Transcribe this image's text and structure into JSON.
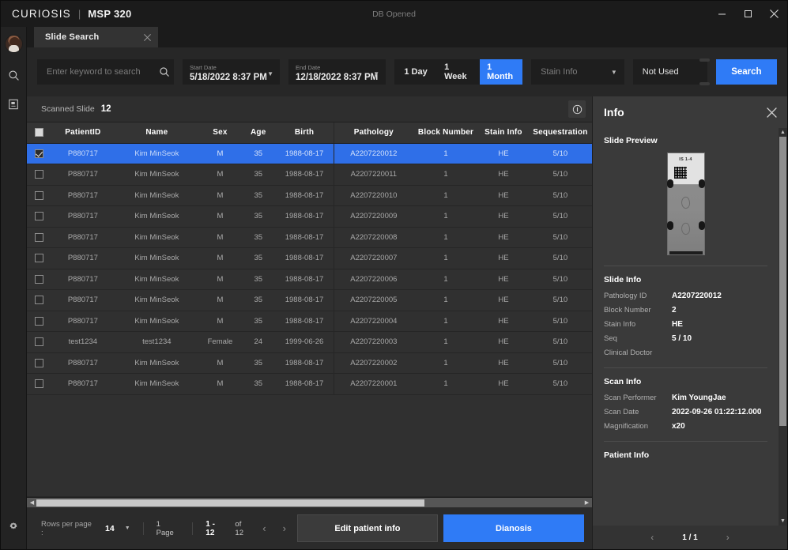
{
  "titlebar": {
    "brand": "CURIOSIS",
    "separator": "|",
    "model": "MSP 320",
    "db_status": "DB Opened",
    "minimize": "minimize-icon",
    "maximize": "maximize-icon",
    "close": "close-icon"
  },
  "rail": {
    "avatar": "user-avatar",
    "items": [
      {
        "icon": "search-icon"
      },
      {
        "icon": "book-icon"
      }
    ],
    "settings": {
      "icon": "gear-icon"
    }
  },
  "tabs": [
    {
      "label": "Slide Search",
      "close": "close-icon",
      "active": true
    }
  ],
  "toolbar": {
    "search_placeholder": "Enter keyword to search",
    "search_value": "",
    "start_date": {
      "caption": "Start Date",
      "value": "5/18/2022 8:37 PM"
    },
    "end_date": {
      "caption": "End Date",
      "value": "12/18/2022 8:37 PM"
    },
    "ranges": [
      {
        "label": "1 Day",
        "active": false
      },
      {
        "label": "1 Week",
        "active": false
      },
      {
        "label": "1 Month",
        "active": true
      }
    ],
    "stain_select": "Stain Info",
    "not_used": "Not Used",
    "search_button": "Search"
  },
  "list": {
    "scanned_label": "Scanned Slide",
    "scanned_count": "12",
    "info_icon": "info-circle-icon",
    "columns": [
      "PatientID",
      "Name",
      "Sex",
      "Age",
      "Birth",
      "Pathology",
      "Block Number",
      "Stain Info",
      "Sequestration"
    ],
    "rows": [
      {
        "selected": true,
        "checked": true,
        "patient_id": "P880717",
        "name": "Kim MinSeok",
        "sex": "M",
        "age": "35",
        "birth": "1988-08-17",
        "pathology": "A2207220012",
        "block_number": "1",
        "stain_info": "HE",
        "sequestration": "5/10"
      },
      {
        "selected": false,
        "checked": false,
        "patient_id": "P880717",
        "name": "Kim MinSeok",
        "sex": "M",
        "age": "35",
        "birth": "1988-08-17",
        "pathology": "A2207220011",
        "block_number": "1",
        "stain_info": "HE",
        "sequestration": "5/10"
      },
      {
        "selected": false,
        "checked": false,
        "patient_id": "P880717",
        "name": "Kim MinSeok",
        "sex": "M",
        "age": "35",
        "birth": "1988-08-17",
        "pathology": "A2207220010",
        "block_number": "1",
        "stain_info": "HE",
        "sequestration": "5/10"
      },
      {
        "selected": false,
        "checked": false,
        "patient_id": "P880717",
        "name": "Kim MinSeok",
        "sex": "M",
        "age": "35",
        "birth": "1988-08-17",
        "pathology": "A2207220009",
        "block_number": "1",
        "stain_info": "HE",
        "sequestration": "5/10"
      },
      {
        "selected": false,
        "checked": false,
        "patient_id": "P880717",
        "name": "Kim MinSeok",
        "sex": "M",
        "age": "35",
        "birth": "1988-08-17",
        "pathology": "A2207220008",
        "block_number": "1",
        "stain_info": "HE",
        "sequestration": "5/10"
      },
      {
        "selected": false,
        "checked": false,
        "patient_id": "P880717",
        "name": "Kim MinSeok",
        "sex": "M",
        "age": "35",
        "birth": "1988-08-17",
        "pathology": "A2207220007",
        "block_number": "1",
        "stain_info": "HE",
        "sequestration": "5/10"
      },
      {
        "selected": false,
        "checked": false,
        "patient_id": "P880717",
        "name": "Kim MinSeok",
        "sex": "M",
        "age": "35",
        "birth": "1988-08-17",
        "pathology": "A2207220006",
        "block_number": "1",
        "stain_info": "HE",
        "sequestration": "5/10"
      },
      {
        "selected": false,
        "checked": false,
        "patient_id": "P880717",
        "name": "Kim MinSeok",
        "sex": "M",
        "age": "35",
        "birth": "1988-08-17",
        "pathology": "A2207220005",
        "block_number": "1",
        "stain_info": "HE",
        "sequestration": "5/10"
      },
      {
        "selected": false,
        "checked": false,
        "patient_id": "P880717",
        "name": "Kim MinSeok",
        "sex": "M",
        "age": "35",
        "birth": "1988-08-17",
        "pathology": "A2207220004",
        "block_number": "1",
        "stain_info": "HE",
        "sequestration": "5/10"
      },
      {
        "selected": false,
        "checked": false,
        "patient_id": "test1234",
        "name": "test1234",
        "sex": "Female",
        "age": "24",
        "birth": "1999-06-26",
        "pathology": "A2207220003",
        "block_number": "1",
        "stain_info": "HE",
        "sequestration": "5/10"
      },
      {
        "selected": false,
        "checked": false,
        "patient_id": "P880717",
        "name": "Kim MinSeok",
        "sex": "M",
        "age": "35",
        "birth": "1988-08-17",
        "pathology": "A2207220002",
        "block_number": "1",
        "stain_info": "HE",
        "sequestration": "5/10"
      },
      {
        "selected": false,
        "checked": false,
        "patient_id": "P880717",
        "name": "Kim MinSeok",
        "sex": "M",
        "age": "35",
        "birth": "1988-08-17",
        "pathology": "A2207220001",
        "block_number": "1",
        "stain_info": "HE",
        "sequestration": "5/10"
      }
    ]
  },
  "footer": {
    "rows_per_page_label": "Rows per page :",
    "rows_per_page_value": "14",
    "page_label": "1 Page",
    "page_range": "1 - 12",
    "page_of": "of 12",
    "prev": "chevron-left-icon",
    "next": "chevron-right-icon",
    "edit_button": "Edit patient info",
    "diagnosis_button": "Dianosis"
  },
  "info": {
    "title": "Info",
    "close": "close-icon",
    "preview_title": "Slide Preview",
    "preview_label": "IS 1-4",
    "slide_info_title": "Slide Info",
    "slide_info": [
      {
        "key": "Pathology ID",
        "value": "A2207220012"
      },
      {
        "key": "Block Number",
        "value": "2"
      },
      {
        "key": "Stain Info",
        "value": "HE"
      },
      {
        "key": "Seq",
        "value": "5 / 10"
      },
      {
        "key": "Clinical Doctor",
        "value": ""
      }
    ],
    "scan_info_title": "Scan Info",
    "scan_info": [
      {
        "key": "Scan Performer",
        "value": "Kim YoungJae"
      },
      {
        "key": "Scan Date",
        "value": "2022-09-26 01:22:12.000"
      },
      {
        "key": "Magnification",
        "value": "x20"
      }
    ],
    "patient_info_title": "Patient Info",
    "pager": {
      "prev": "chevron-left-icon",
      "page": "1 / 1",
      "next": "chevron-right-icon"
    }
  },
  "colors": {
    "accent": "#2f7bf6",
    "selection": "#2f6fe8",
    "window_bg": "#2b2b2b",
    "panel_bg": "#3a3a3a",
    "titlebar_bg": "#1b1b1b"
  }
}
